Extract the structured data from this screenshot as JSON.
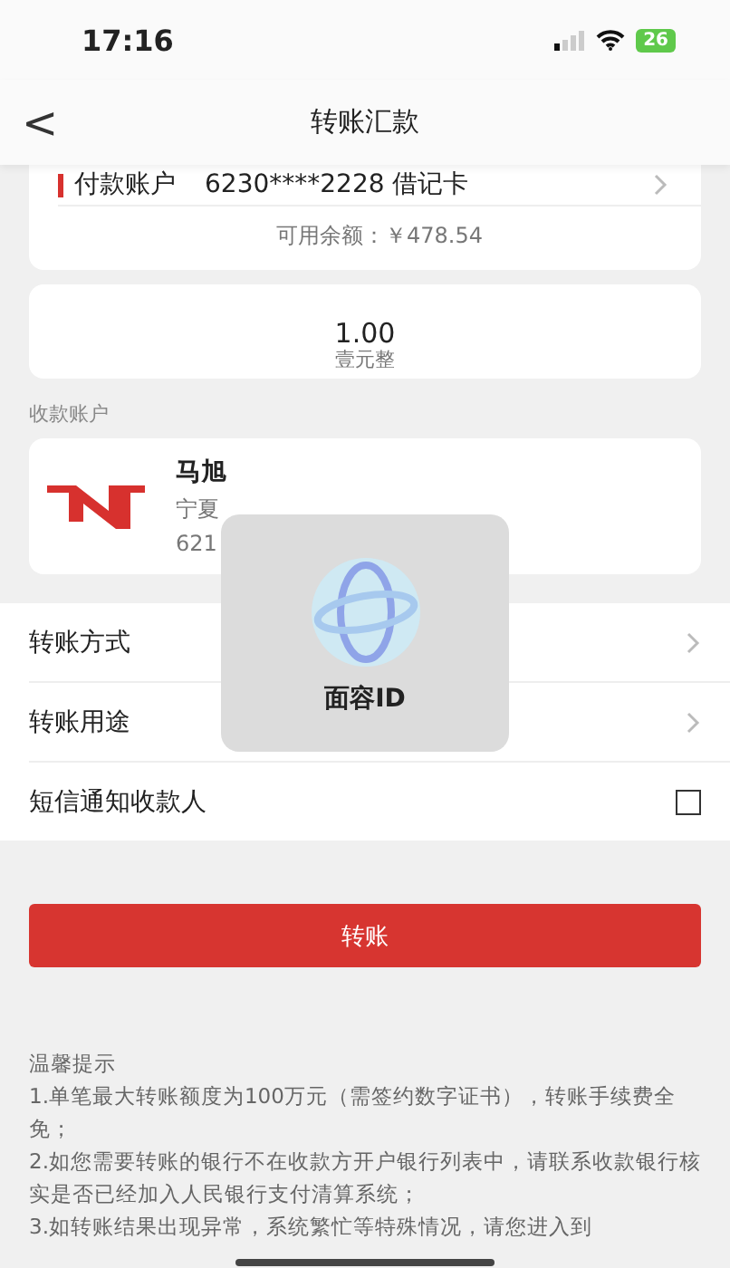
{
  "status_bar": {
    "time": "17:16",
    "battery": "26"
  },
  "nav": {
    "back": "<",
    "title": "转账汇款"
  },
  "payer": {
    "label": "付款账户",
    "account": "6230****2228 借记卡",
    "balance": "可用余额：￥478.54"
  },
  "amount": {
    "value": "1.00",
    "words": "壹元整"
  },
  "payee_section": {
    "label": "收款账户",
    "name": "马旭",
    "bank": "宁夏",
    "account": "621"
  },
  "options": [
    {
      "kind": "link",
      "label": "转账方式"
    },
    {
      "kind": "link",
      "label": "转账用途"
    },
    {
      "kind": "checkbox",
      "label": "短信通知收款人",
      "checked": false
    }
  ],
  "submit": "转账",
  "face_id": {
    "label": "面容ID"
  },
  "tips": {
    "title": "温馨提示",
    "lines": [
      "1.单笔最大转账额度为100万元（需签约数字证书），转账手续费全免；",
      "2.如您需要转账的银行不在收款方开户银行列表中，请联系收款银行核实是否已经加入人民银行支付清算系统；",
      "3.如转账结果出现异常，系统繁忙等特殊情况，请您进入到"
    ]
  }
}
